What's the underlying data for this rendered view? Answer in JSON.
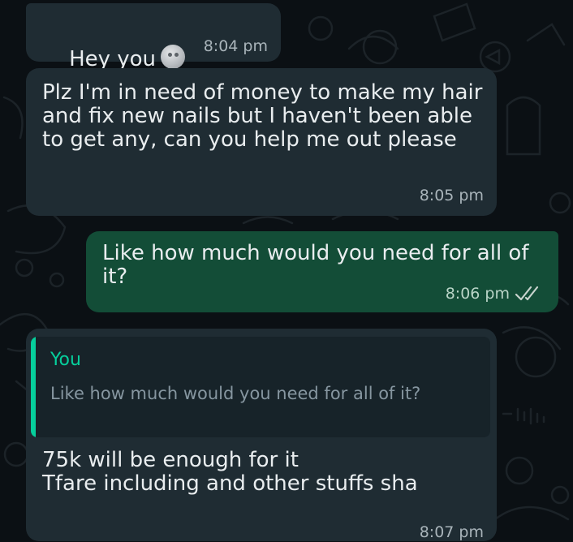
{
  "theme": {
    "background": "#0b1014",
    "incoming_bubble": "#1f2c33",
    "outgoing_bubble": "#134d37",
    "quote_accent": "#06cf9c",
    "read_tick_color": "#c7d3cd"
  },
  "messages": [
    {
      "direction": "incoming",
      "text": "Hey you",
      "emoji": "new-moon-face-emoji",
      "time": "8:04 pm"
    },
    {
      "direction": "incoming",
      "text": "Plz I'm in need of money to make my hair and fix new nails but I haven't been able to get any, can you help me out please",
      "time": "8:05 pm"
    },
    {
      "direction": "outgoing",
      "text": "Like how much would you need for all of it?",
      "time": "8:06 pm",
      "status_icon": "double-check-icon"
    },
    {
      "direction": "incoming",
      "quote": {
        "author": "You",
        "text": "Like how much would you need for all of it?"
      },
      "text": "75k will be enough for it\nTfare including and other stuffs sha",
      "time": "8:07 pm"
    }
  ]
}
